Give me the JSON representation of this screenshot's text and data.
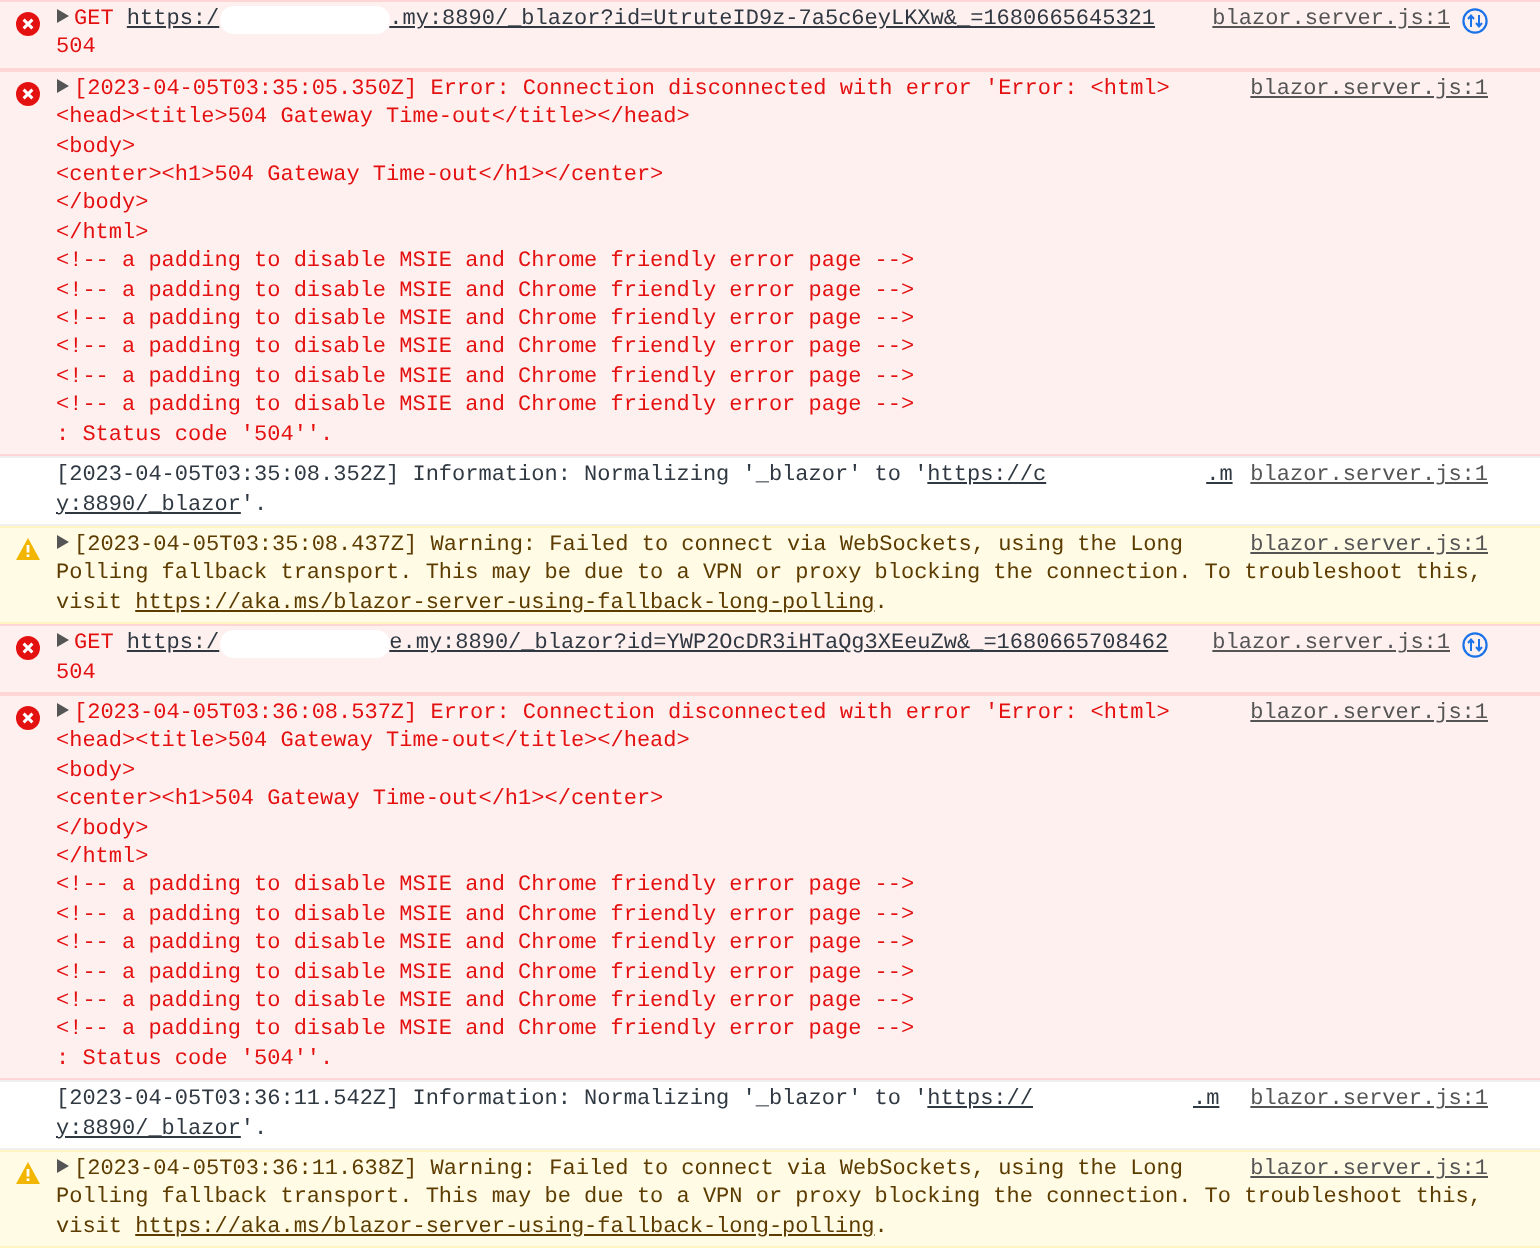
{
  "console_entries": [
    {
      "kind": "network",
      "expanded": false,
      "method": "GET",
      "url_start": "https:/",
      "url_end": ".my:8890/_blazor?id=UtruteID9z-7a5c6eyLKXw&_=1680665645321",
      "status": "504",
      "source": "blazor.server.js:1"
    },
    {
      "kind": "error",
      "expanded": false,
      "lines": [
        "[2023-04-05T03:35:05.350Z] Error: Connection disconnected with error 'Error: <html>",
        "<head><title>504 Gateway Time-out</title></head>",
        "<body>",
        "<center><h1>504 Gateway Time-out</h1></center>",
        "</body>",
        "</html>",
        "<!-- a padding to disable MSIE and Chrome friendly error page -->",
        "<!-- a padding to disable MSIE and Chrome friendly error page -->",
        "<!-- a padding to disable MSIE and Chrome friendly error page -->",
        "<!-- a padding to disable MSIE and Chrome friendly error page -->",
        "<!-- a padding to disable MSIE and Chrome friendly error page -->",
        "<!-- a padding to disable MSIE and Chrome friendly error page -->",
        ": Status code '504''."
      ],
      "source": "blazor.server.js:1"
    },
    {
      "kind": "info",
      "text": "[2023-04-05T03:35:08.352Z] Information: Normalizing '_blazor' to '",
      "link_start": "https://c",
      "link_end": ".m",
      "link_wrap": "y:8890/_blazor",
      "text_after": "'.",
      "source": "blazor.server.js:1"
    },
    {
      "kind": "warning",
      "expanded": false,
      "lines": [
        "[2023-04-05T03:35:08.437Z] Warning: Failed to connect via WebSockets, using the Long",
        "Polling fallback transport. This may be due to a VPN or proxy blocking the connection. To troubleshoot this,"
      ],
      "link_prefix": "visit ",
      "link": "https://aka.ms/blazor-server-using-fallback-long-polling",
      "text_after": ".",
      "source": "blazor.server.js:1"
    },
    {
      "kind": "network",
      "expanded": false,
      "method": "GET",
      "url_start": "https:/",
      "url_end": "e.my:8890/_blazor?id=YWP2OcDR3iHTaQg3XEeuZw&_=1680665708462",
      "status": "504",
      "source": "blazor.server.js:1"
    },
    {
      "kind": "error",
      "expanded": false,
      "lines": [
        "[2023-04-05T03:36:08.537Z] Error: Connection disconnected with error 'Error: <html>",
        "<head><title>504 Gateway Time-out</title></head>",
        "<body>",
        "<center><h1>504 Gateway Time-out</h1></center>",
        "</body>",
        "</html>",
        "<!-- a padding to disable MSIE and Chrome friendly error page -->",
        "<!-- a padding to disable MSIE and Chrome friendly error page -->",
        "<!-- a padding to disable MSIE and Chrome friendly error page -->",
        "<!-- a padding to disable MSIE and Chrome friendly error page -->",
        "<!-- a padding to disable MSIE and Chrome friendly error page -->",
        "<!-- a padding to disable MSIE and Chrome friendly error page -->",
        ": Status code '504''."
      ],
      "source": "blazor.server.js:1"
    },
    {
      "kind": "info",
      "text": "[2023-04-05T03:36:11.542Z] Information: Normalizing '_blazor' to '",
      "link_start": "https://",
      "link_end": ".m",
      "link_wrap": "y:8890/_blazor",
      "text_after": "'.",
      "source": "blazor.server.js:1"
    },
    {
      "kind": "warning",
      "expanded": false,
      "lines": [
        "[2023-04-05T03:36:11.638Z] Warning: Failed to connect via WebSockets, using the Long",
        "Polling fallback transport. This may be due to a VPN or proxy blocking the connection. To troubleshoot this,"
      ],
      "link_prefix": "visit ",
      "link": "https://aka.ms/blazor-server-using-fallback-long-polling",
      "text_after": ".",
      "source": "blazor.server.js:1"
    }
  ]
}
